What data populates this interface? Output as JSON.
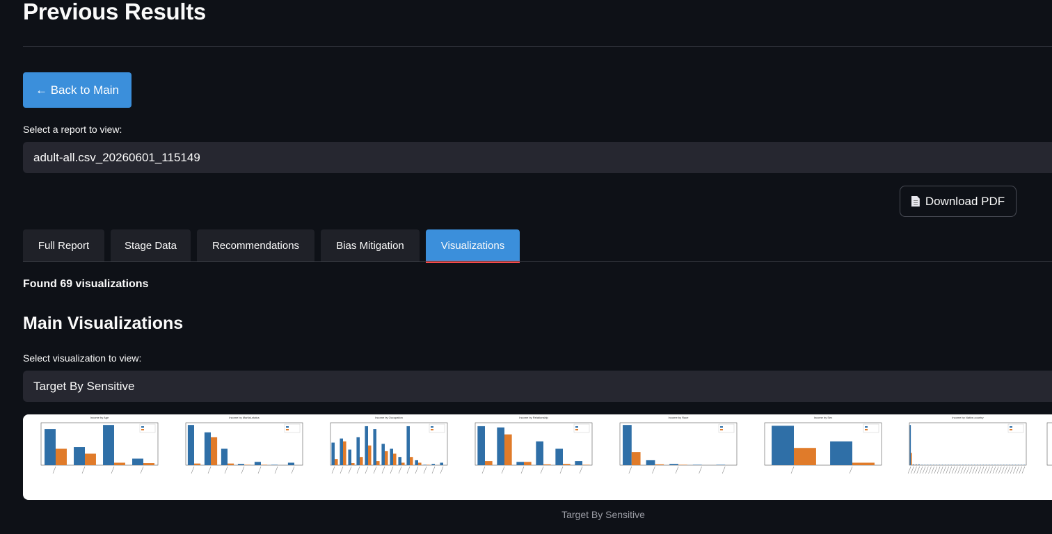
{
  "page": {
    "title": "Previous Results",
    "back_button": "← Back to Main",
    "report_label": "Select a report to view:",
    "report_value": "adult-all.csv_20260601_115149",
    "download_pdf": "Download PDF",
    "found_text": "Found 69 visualizations",
    "section_title": "Main Visualizations",
    "viz_label": "Select visualization to view:",
    "viz_value": "Target By Sensitive",
    "caption": "Target By Sensitive"
  },
  "tabs": [
    {
      "label": "Full Report",
      "active": false
    },
    {
      "label": "Stage Data",
      "active": false
    },
    {
      "label": "Recommendations",
      "active": false
    },
    {
      "label": "Bias Mitigation",
      "active": false
    },
    {
      "label": "Visualizations",
      "active": true
    }
  ],
  "colors": {
    "accent": "#3b8fdb",
    "tab_underline": "#ff4b4b",
    "series_low": "#2f6fa7",
    "series_high": "#e07b2a"
  },
  "chart_data": [
    {
      "type": "bar",
      "title": "Income by Age",
      "categories": [
        "a",
        "b",
        "c",
        "d"
      ],
      "series": [
        {
          "values": [
            0.88,
            0.44,
            0.98,
            0.16
          ]
        },
        {
          "values": [
            0.4,
            0.28,
            0.06,
            0.05
          ]
        }
      ]
    },
    {
      "type": "bar",
      "title": "Income by Marital-status",
      "categories": [
        "a",
        "b",
        "c",
        "d",
        "e",
        "f",
        "g"
      ],
      "series": [
        {
          "values": [
            0.98,
            0.8,
            0.4,
            0.03,
            0.08,
            0.01,
            0.06
          ]
        },
        {
          "values": [
            0.04,
            0.68,
            0.04,
            0.01,
            0.01,
            0.0,
            0.0
          ]
        }
      ]
    },
    {
      "type": "bar",
      "title": "Income by Occupation",
      "categories": [
        "a",
        "b",
        "c",
        "d",
        "e",
        "f",
        "g",
        "h",
        "i",
        "j",
        "k",
        "l",
        "m",
        "n"
      ],
      "series": [
        {
          "values": [
            0.55,
            0.65,
            0.38,
            0.68,
            0.95,
            0.88,
            0.52,
            0.4,
            0.2,
            0.95,
            0.12,
            0.01,
            0.03,
            0.06
          ]
        },
        {
          "values": [
            0.15,
            0.58,
            0.05,
            0.2,
            0.48,
            0.1,
            0.34,
            0.28,
            0.06,
            0.2,
            0.06,
            0.01,
            0.0,
            0.0
          ]
        }
      ]
    },
    {
      "type": "bar",
      "title": "Income by Relationship",
      "categories": [
        "a",
        "b",
        "c",
        "d",
        "e",
        "f"
      ],
      "series": [
        {
          "values": [
            0.95,
            0.92,
            0.08,
            0.58,
            0.4,
            0.1
          ]
        },
        {
          "values": [
            0.1,
            0.75,
            0.08,
            0.02,
            0.03,
            0.01
          ]
        }
      ]
    },
    {
      "type": "bar",
      "title": "Income by Race",
      "categories": [
        "a",
        "b",
        "c",
        "d",
        "e"
      ],
      "series": [
        {
          "values": [
            0.98,
            0.12,
            0.03,
            0.01,
            0.01
          ]
        },
        {
          "values": [
            0.32,
            0.02,
            0.01,
            0.0,
            0.0
          ]
        }
      ]
    },
    {
      "type": "bar",
      "title": "Income by Sex",
      "categories": [
        "a",
        "b"
      ],
      "series": [
        {
          "values": [
            0.96,
            0.58
          ]
        },
        {
          "values": [
            0.42,
            0.06
          ]
        }
      ]
    },
    {
      "type": "bar",
      "title": "Income by Native-country",
      "categories": [
        "a",
        "b",
        "c",
        "d",
        "e",
        "f",
        "g",
        "h",
        "i",
        "j",
        "k",
        "l",
        "m",
        "n",
        "o",
        "p",
        "q",
        "r",
        "s",
        "t",
        "u",
        "v",
        "w",
        "x",
        "y",
        "z",
        "aa",
        "ab",
        "ac",
        "ad",
        "ae",
        "af",
        "ag",
        "ah",
        "ai",
        "aj",
        "ak",
        "al",
        "am",
        "an"
      ],
      "series": [
        {
          "values": [
            0.98,
            0.02,
            0.02,
            0.02,
            0.01,
            0.01,
            0.01,
            0.01,
            0.01,
            0.01,
            0.01,
            0.01,
            0.01,
            0.01,
            0.01,
            0.01,
            0.01,
            0.01,
            0.01,
            0.01,
            0.01,
            0.01,
            0.01,
            0.01,
            0.01,
            0.01,
            0.01,
            0.01,
            0.01,
            0.01,
            0.01,
            0.01,
            0.01,
            0.01,
            0.01,
            0.01,
            0.01,
            0.01,
            0.01,
            0.01
          ]
        },
        {
          "values": [
            0.3,
            0.01,
            0.01,
            0.0,
            0.0,
            0.0,
            0.0,
            0.0,
            0.0,
            0.0,
            0.0,
            0.0,
            0.0,
            0.0,
            0.0,
            0.0,
            0.0,
            0.0,
            0.0,
            0.0,
            0.0,
            0.0,
            0.0,
            0.0,
            0.0,
            0.0,
            0.0,
            0.0,
            0.0,
            0.0,
            0.0,
            0.0,
            0.0,
            0.0,
            0.0,
            0.0,
            0.0,
            0.0,
            0.0,
            0.0
          ]
        }
      ]
    }
  ]
}
